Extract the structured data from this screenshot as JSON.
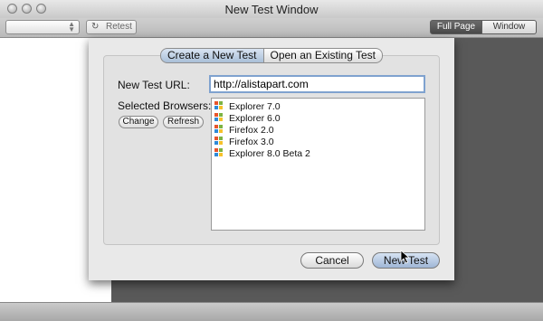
{
  "window": {
    "title": "New Test Window"
  },
  "toolbar": {
    "retest_label": "Retest",
    "view_modes": [
      {
        "label": "Full Page",
        "selected": true
      },
      {
        "label": "Window",
        "selected": false
      }
    ]
  },
  "sheet": {
    "tabs": [
      {
        "label": "Create a New Test",
        "selected": true
      },
      {
        "label": "Open an Existing Test",
        "selected": false
      }
    ],
    "url_label": "New Test URL:",
    "url_value": "http://alistapart.com",
    "browsers_label": "Selected Browsers:",
    "change_label": "Change",
    "refresh_label": "Refresh",
    "browsers": [
      {
        "name": "Explorer 7.0",
        "icon": "windows-icon"
      },
      {
        "name": "Explorer 6.0",
        "icon": "windows-icon"
      },
      {
        "name": "Firefox 2.0",
        "icon": "windows-icon"
      },
      {
        "name": "Firefox 3.0",
        "icon": "windows-icon"
      },
      {
        "name": "Explorer 8.0 Beta 2",
        "icon": "windows-icon"
      }
    ],
    "cancel_label": "Cancel",
    "new_test_label": "New Test"
  },
  "colors": {
    "accent": "#a9bfd8",
    "focus_ring": "#7fa2cf",
    "windows_logo": [
      "#e8552b",
      "#7cb342",
      "#2f8ad8",
      "#f6c12a"
    ]
  }
}
